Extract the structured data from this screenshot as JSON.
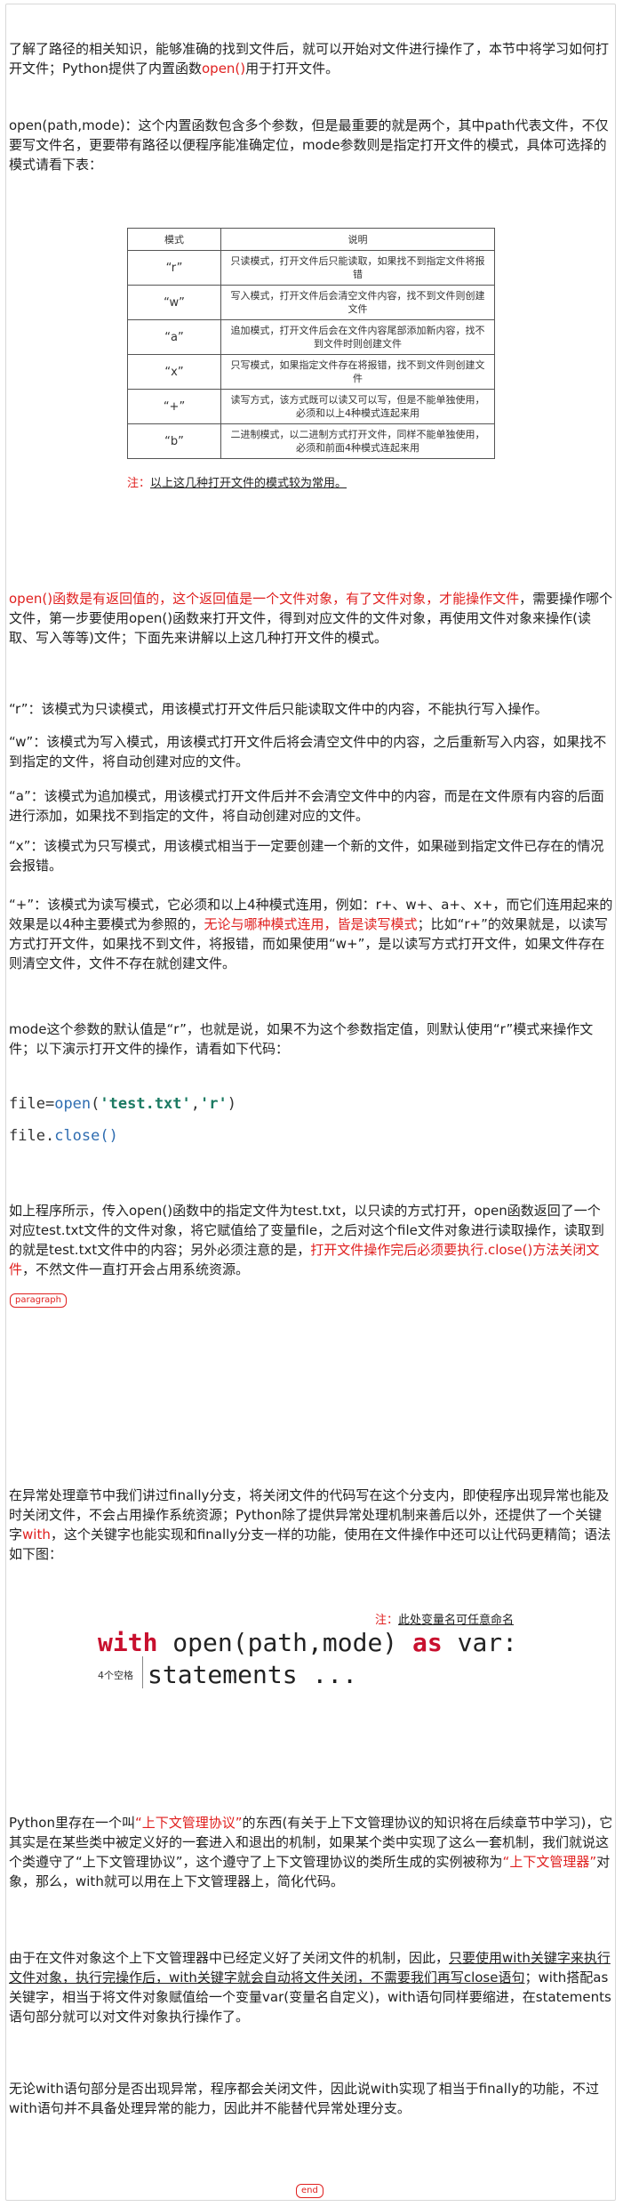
{
  "intro": {
    "text1": "了解了路径的相关知识，能够准确的找到文件后，就可以开始对文件进行操作了，本节中将学习如何打开文件；Python提供了内置函数",
    "open_fn": "open()",
    "text2": "用于打开文件。"
  },
  "open_desc": {
    "text": "open(path,mode)：这个内置函数包含多个参数，但是最重要的就是两个，其中path代表文件，不仅要写文件名，更要带有路径以便程序能准确定位，mode参数则是指定打开文件的模式，具体可选择的模式请看下表："
  },
  "modes_table": {
    "headers": [
      "模式",
      "说明"
    ],
    "rows": [
      {
        "mode": "“r”",
        "desc": "只读模式，打开文件后只能读取，如果找不到指定文件将报错"
      },
      {
        "mode": "“w”",
        "desc": "写入模式，打开文件后会清空文件内容，找不到文件则创建文件"
      },
      {
        "mode": "“a”",
        "desc": "追加模式，打开文件后会在文件内容尾部添加新内容，找不到文件时则创建文件"
      },
      {
        "mode": "“x”",
        "desc": "只写模式，如果指定文件存在将报错，找不到文件则创建文件"
      },
      {
        "mode": "“+”",
        "desc": "读写方式，该方式既可以读又可以写，但是不能单独使用，必须和以上4种模式连起来用"
      },
      {
        "mode": "“b”",
        "desc": "二进制模式，以二进制方式打开文件，同样不能单独使用，必须和前面4种模式连起来用"
      }
    ],
    "note_label": "注：",
    "note_text": "以上这几种打开文件的模式较为常用。"
  },
  "return_para": {
    "red_text": "open()函数是有返回值的，这个返回值是一个文件对象，有了文件对象，才能操作文件",
    "rest_text": "，需要操作哪个文件，第一步要使用open()函数来打开文件，得到对应文件的文件对象，再使用文件对象来操作(读取、写入等等)文件；下面先来讲解以上这几种打开文件的模式。"
  },
  "mode_r": "“r”：该模式为只读模式，用该模式打开文件后只能读取文件中的内容，不能执行写入操作。",
  "mode_w": "“w”：该模式为写入模式，用该模式打开文件后将会清空文件中的内容，之后重新写入内容，如果找不到指定的文件，将自动创建对应的文件。",
  "mode_a": "“a”：该模式为追加模式，用该模式打开文件后并不会清空文件中的内容，而是在文件原有内容的后面进行添加，如果找不到指定的文件，将自动创建对应的文件。",
  "mode_x": "“x”：该模式为只写模式，用该模式相当于一定要创建一个新的文件，如果碰到指定文件已存在的情况会报错。",
  "mode_plus": {
    "text1": "“+”：该模式为读写模式，它必须和以上4种模式连用，例如：r+、w+、a+、x+，而它们连用起来的效果是以4种主要模式为参照的，",
    "red_text": "无论与哪种模式连用，皆是读写模式",
    "text2": "；比如“r+”的效果就是，以读写方式打开文件，如果找不到文件，将报错，而如果使用“w+”，是以读写方式打开文件，如果文件存在则清空文件，文件不存在就创建文件。"
  },
  "default_para": "mode这个参数的默认值是“r”，也就是说，如果不为这个参数指定值，则默认使用“r”模式来操作文件；以下演示打开文件的操作，请看如下代码：",
  "code1": {
    "var": "file",
    "eq": "=",
    "fn": "open",
    "lp": "(",
    "arg1": "'test.txt'",
    "comma": ",",
    "arg2": "'r'",
    "rp": ")"
  },
  "code2": {
    "var": "file",
    "dot": ".",
    "method": "close",
    "parens": "()"
  },
  "explain_para": {
    "text1": "如上程序所示，传入open()函数中的指定文件为test.txt，以只读的方式打开，open函数返回了一个对应test.txt文件的文件对象，将它赋值给了变量file，之后对这个file文件对象进行读取操作，读取到的就是test.txt文件中的内容；另外必须注意的是，",
    "red_text": "打开文件操作完后必须要执行.close()方法关闭文件",
    "text2": "，不然文件一直打开会占用系统资源。"
  },
  "tag_paragraph": "paragraph",
  "with_para": {
    "text1": "在异常处理章节中我们讲过finally分支，将关闭文件的代码写在这个分支内，即使程序出现异常也能及时关闭文件，不会占用操作系统资源；Python除了提供异常处理机制来善后以外，还提供了一个关键字",
    "red_text": "with",
    "text2": "，这个关键字也能实现和finally分支一样的功能，使用在文件操作中还可以让代码更精简；语法如下图："
  },
  "syntax": {
    "note_label": "注：",
    "note_text": "此处变量名可任意命名",
    "kw_with": "with",
    "call": " open(path,mode) ",
    "kw_as": "as",
    "var": " var:",
    "indent_note": "4个空格",
    "body": "statements ..."
  },
  "context_para": {
    "text1": "Python里存在一个叫",
    "red1": "“上下文管理协议”",
    "text2": "的东西(有关于上下文管理协议的知识将在后续章节中学习)，它其实是在某些类中被定义好的一套进入和退出的机制，如果某个类中实现了这么一套机制，我们就说这个类遵守了“上下文管理协议”，这个遵守了上下文管理协议的类所生成的实例被称为",
    "red2": "“上下文管理器”",
    "text3": "对象，那么，with就可以用在上下文管理器上，简化代码。"
  },
  "fileobj_para": {
    "text1": "由于在文件对象这个上下文管理器中已经定义好了关闭文件的机制，因此，",
    "underline_text": "只要使用with关键字来执行文件对象，执行完操作后，with关键字就会自动将文件关闭，不需要我们再写close语句",
    "text2": "；with搭配as关键字，相当于将文件对象赋值给一个变量var(变量名自定义)，with语句同样要缩进，在statements语句部分就可以对文件对象执行操作了。"
  },
  "final_para": "无论with语句部分是否出现异常，程序都会关闭文件，因此说with实现了相当于finally的功能，不过with语句并不具备处理异常的能力，因此并不能替代异常处理分支。",
  "tag_end": "end"
}
